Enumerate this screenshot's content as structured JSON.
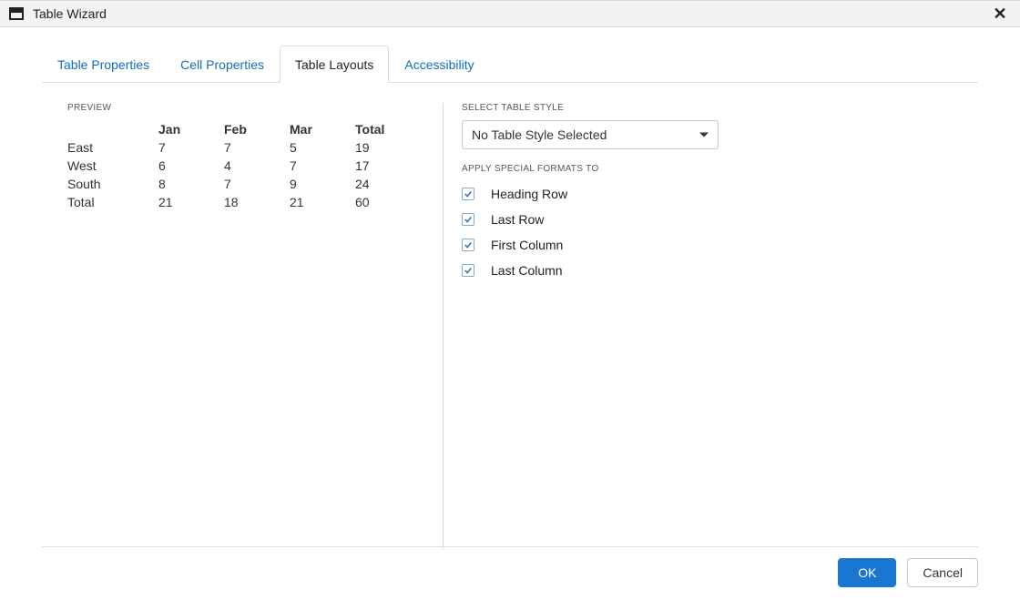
{
  "header": {
    "title": "Table Wizard"
  },
  "tabs": [
    {
      "label": "Table Properties",
      "active": false
    },
    {
      "label": "Cell Properties",
      "active": false
    },
    {
      "label": "Table Layouts",
      "active": true
    },
    {
      "label": "Accessibility",
      "active": false
    }
  ],
  "preview": {
    "section_label": "PREVIEW",
    "columns": [
      "Jan",
      "Feb",
      "Mar",
      "Total"
    ],
    "rows": [
      {
        "label": "East",
        "cells": [
          "7",
          "7",
          "5",
          "19"
        ]
      },
      {
        "label": "West",
        "cells": [
          "6",
          "4",
          "7",
          "17"
        ]
      },
      {
        "label": "South",
        "cells": [
          "8",
          "7",
          "9",
          "24"
        ]
      },
      {
        "label": "Total",
        "cells": [
          "21",
          "18",
          "21",
          "60"
        ]
      }
    ]
  },
  "style": {
    "select_label": "SELECT TABLE STYLE",
    "dropdown_value": "No Table Style Selected",
    "formats_label": "APPLY SPECIAL FORMATS TO",
    "formats": [
      {
        "label": "Heading Row",
        "checked": true
      },
      {
        "label": "Last Row",
        "checked": true
      },
      {
        "label": "First Column",
        "checked": true
      },
      {
        "label": "Last Column",
        "checked": true
      }
    ]
  },
  "footer": {
    "ok": "OK",
    "cancel": "Cancel"
  },
  "colors": {
    "accent": "#1976d2"
  },
  "chart_data": {
    "type": "table",
    "columns": [
      "",
      "Jan",
      "Feb",
      "Mar",
      "Total"
    ],
    "rows": [
      [
        "East",
        7,
        7,
        5,
        19
      ],
      [
        "West",
        6,
        4,
        7,
        17
      ],
      [
        "South",
        8,
        7,
        9,
        24
      ],
      [
        "Total",
        21,
        18,
        21,
        60
      ]
    ]
  }
}
